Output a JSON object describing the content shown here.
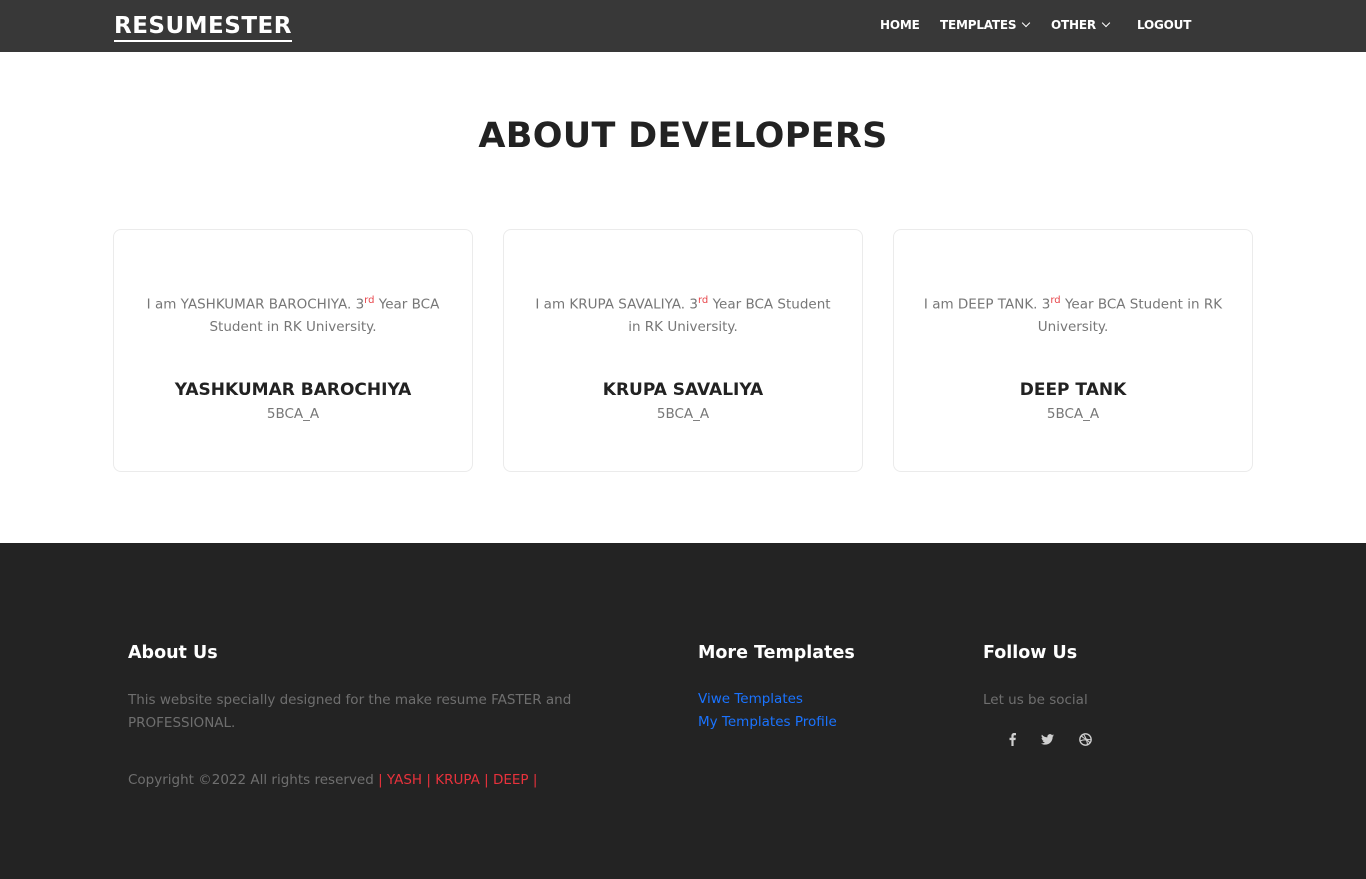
{
  "navbar": {
    "brand": "RESUMESTER",
    "items": [
      {
        "label": "HOME",
        "has_dropdown": false
      },
      {
        "label": "TEMPLATES",
        "has_dropdown": true
      },
      {
        "label": "OTHER",
        "has_dropdown": true
      },
      {
        "label": "LOGOUT",
        "has_dropdown": false
      }
    ]
  },
  "main": {
    "title": "ABOUT DEVELOPERS",
    "developers": [
      {
        "intro": "I am YASHKUMAR BAROCHIYA. 3",
        "sup": "rd",
        "intro_rest": " Year BCA Student in RK University.",
        "name": "YASHKUMAR BAROCHIYA",
        "class": "5BCA_A"
      },
      {
        "intro": "I am KRUPA SAVALIYA. 3",
        "sup": "rd",
        "intro_rest": " Year BCA Student in RK University.",
        "name": "KRUPA SAVALIYA",
        "class": "5BCA_A"
      },
      {
        "intro": "I am DEEP TANK. 3",
        "sup": "rd",
        "intro_rest": " Year BCA Student in RK University.",
        "name": "DEEP TANK",
        "class": "5BCA_A"
      }
    ]
  },
  "footer": {
    "about": {
      "heading": "About Us",
      "text": "This website specially designed for the make resume FASTER and PROFESSIONAL."
    },
    "copyright": {
      "text": "Copyright ©2022 All rights reserved ",
      "credits": "| YASH | KRUPA | DEEP |"
    },
    "templates": {
      "heading": "More Templates",
      "links": [
        "Viwe Templates",
        "My Templates Profile"
      ]
    },
    "follow": {
      "heading": "Follow Us",
      "text": "Let us be social",
      "icons": [
        "facebook-icon",
        "twitter-icon",
        "dribbble-icon"
      ]
    }
  },
  "colors": {
    "navbar_bg": "#383838",
    "footer_bg": "#232323",
    "link": "#1a73ff",
    "accent_red": "#e8323c"
  }
}
